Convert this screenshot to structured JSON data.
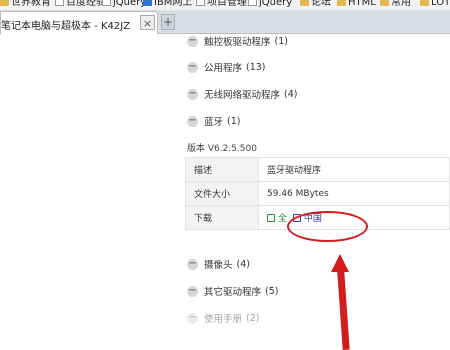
{
  "bookmarks": [
    {
      "label": "世界教育",
      "icon": "folder-icon"
    },
    {
      "label": "百度经验",
      "icon": "page-icon"
    },
    {
      "label": "jQuery",
      "icon": "page-icon"
    },
    {
      "label": "IBM网上",
      "icon": "blue-icon"
    },
    {
      "label": "项目管理",
      "icon": "page-icon"
    },
    {
      "label": "jQuery",
      "icon": "page-icon"
    },
    {
      "label": "论坛",
      "icon": "folder-icon"
    },
    {
      "label": "HTML",
      "icon": "folder-icon"
    },
    {
      "label": "常用",
      "icon": "folder-icon"
    },
    {
      "label": "LOT",
      "icon": "folder-icon"
    }
  ],
  "tab": {
    "title": "笔记本电脑与超极本 - K42JZ",
    "close": "×",
    "new_tab": "+"
  },
  "categories_top": [
    {
      "label": "触控板驱动程序",
      "count": "(1)"
    },
    {
      "label": "公用程序",
      "count": "(13)"
    },
    {
      "label": "无线网络驱动程序",
      "count": "(4)"
    },
    {
      "label": "蓝牙",
      "count": "(1)"
    }
  ],
  "version": "版本 V6.2.5.500",
  "details": {
    "desc_key": "描述",
    "desc_val": "蓝牙驱动程序",
    "size_key": "文件大小",
    "size_val": "59.46 MBytes",
    "download_key": "下载",
    "download_global": "全",
    "download_china": "中国"
  },
  "categories_bottom": [
    {
      "label": "摄像头",
      "count": "(4)"
    },
    {
      "label": "其它驱动程序",
      "count": "(5)"
    },
    {
      "label": "使用手册",
      "count": "(2)"
    }
  ],
  "colors": {
    "annotation": "#d41c1c",
    "download_global": "#2f8a3b",
    "download_china": "#2f3fa0"
  }
}
